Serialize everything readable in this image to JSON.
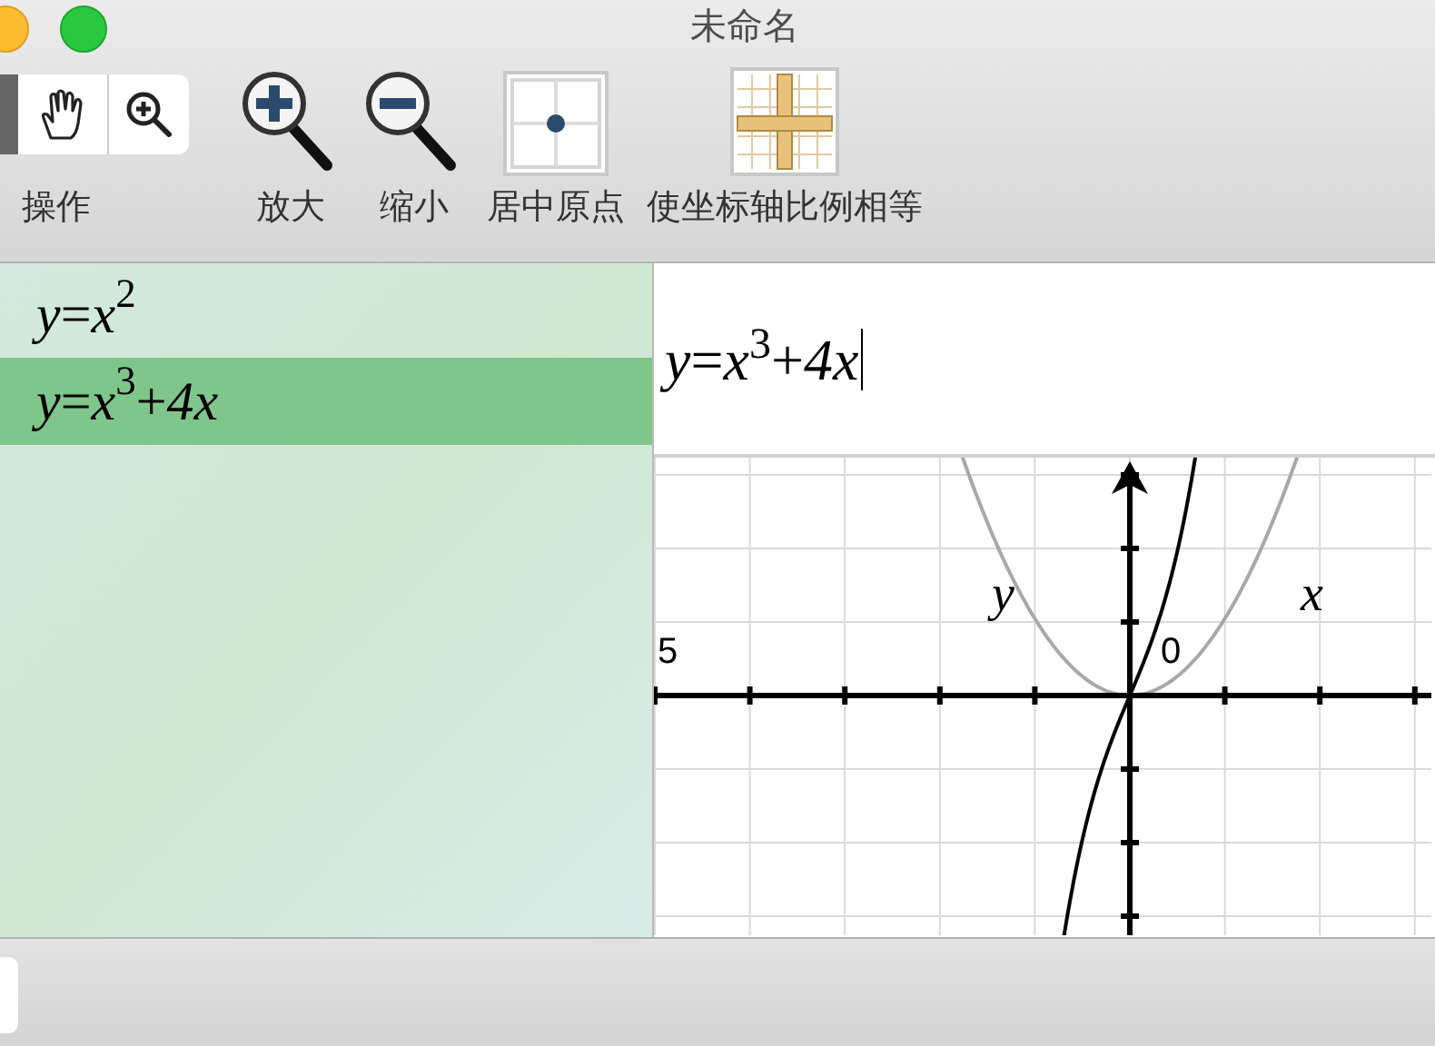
{
  "window": {
    "title": "未命名"
  },
  "toolbar": {
    "items": [
      {
        "kind": "segmented",
        "label": "操作"
      },
      {
        "kind": "zoom-in",
        "label": "放大"
      },
      {
        "kind": "zoom-out",
        "label": "缩小"
      },
      {
        "kind": "center",
        "label": "居中原点"
      },
      {
        "kind": "equal-axes",
        "label": "使坐标轴比例相等"
      }
    ]
  },
  "equations": [
    {
      "text": "*y*=*x*$^{2}$",
      "selected": false
    },
    {
      "text": "*y*=*x*$^{3}$+*4x*",
      "selected": true
    }
  ],
  "formula_field": {
    "value": "*y*=*x*$^{3}$+*4x*"
  },
  "graph": {
    "x_axis_label": "x",
    "y_axis_label": "y",
    "origin_label": "0",
    "tick_label": "5"
  }
}
